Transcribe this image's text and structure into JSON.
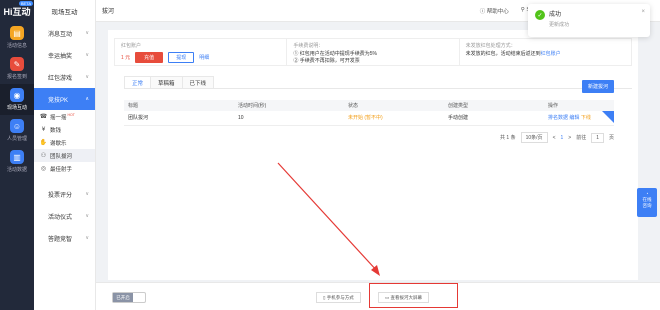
{
  "rail": {
    "logo": "Hi互动",
    "badge": "BETA",
    "items": [
      {
        "label": "活动信息",
        "icon": "calendar-icon",
        "color": "#f5a623"
      },
      {
        "label": "报名签到",
        "icon": "sign-icon",
        "color": "#e74c3c"
      },
      {
        "label": "现场互动",
        "icon": "interact-icon",
        "color": "#3d7ff5"
      },
      {
        "label": "人员管理",
        "icon": "person-icon",
        "color": "#3d7ff5"
      },
      {
        "label": "活动数据",
        "icon": "chart-icon",
        "color": "#3d7ff5"
      }
    ]
  },
  "submenu": {
    "title": "现场互动",
    "items": [
      "消息互动",
      "幸运抽奖",
      "红包游戏",
      "竞技PK"
    ],
    "pk_children": [
      "摇一摇",
      "数钱",
      "谢歇乐",
      "团队拔河",
      "最佳射手"
    ],
    "hot": "HOT",
    "bottom_items": [
      "投票评分",
      "活动仪式",
      "答题竞智"
    ]
  },
  "topbar": {
    "breadcrumb": "拔河",
    "help": "帮助中心",
    "user": "S"
  },
  "info": {
    "account_label": "红包账户",
    "amount": "1 元",
    "recharge": "充值",
    "withdraw": "提现",
    "detail": "明细",
    "fee_label": "手续费说明：",
    "fee_line1": "① 红包用户在活动中提现手续费为5%",
    "fee_line2": "② 手续费不再扣除，可开发票",
    "unused_label": "未发放红包处理方式：",
    "unused_text": "未发放的红包，活动结束后返还到",
    "unused_link": "红包账户"
  },
  "tabs": [
    "正常",
    "草稿箱",
    "已下线"
  ],
  "new_button": "新建拔河",
  "table": {
    "headers": [
      "标题",
      "活动时间(秒)",
      "状态",
      "创建类型",
      "操作"
    ],
    "rows": [
      {
        "title": "团队拔河",
        "time": "10",
        "status": "未开始 (暂不中)",
        "type": "手动创建",
        "ops": [
          "排名数据",
          "编辑",
          "下线"
        ]
      }
    ]
  },
  "pager": {
    "total": "共 1 条",
    "size": "10条/页",
    "prev": "<",
    "page": "1",
    "next": ">",
    "goto": "前往",
    "goto_val": "1",
    "unit": "页"
  },
  "footer": {
    "toggle_on": "已开启",
    "mobile": "手机参与方式",
    "screen": "查看拔河大屏幕"
  },
  "toast": {
    "title": "成功",
    "msg": "更新成功"
  },
  "online": {
    "line1": "在线",
    "line2": "咨询"
  }
}
